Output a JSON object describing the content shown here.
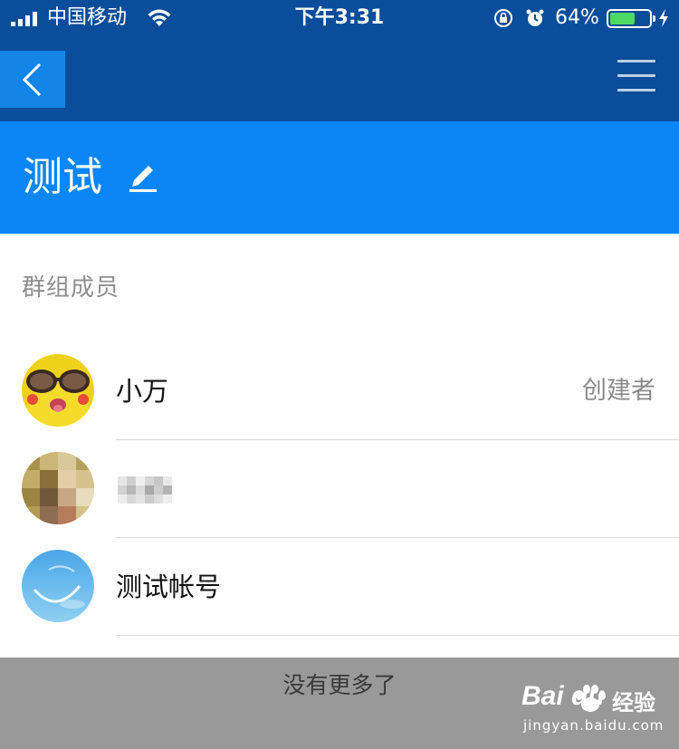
{
  "status_bar": {
    "carrier": "中国移动",
    "time": "下午3:31",
    "battery_percent": "64%",
    "battery_level": 0.64,
    "icons": [
      "signal-icon",
      "wifi-icon",
      "rotation-lock-icon",
      "alarm-icon",
      "battery-icon",
      "charging-icon"
    ]
  },
  "nav": {
    "back_icon": "chevron-left-icon",
    "menu_icon": "hamburger-menu-icon"
  },
  "header": {
    "title": "测试",
    "edit_icon": "pencil-icon"
  },
  "members": {
    "section_label": "群组成员",
    "items": [
      {
        "name": "小万",
        "role": "创建者",
        "avatar": "pikachu-sunglasses-avatar"
      },
      {
        "name": "",
        "role": "",
        "avatar": "pixelated-avatar",
        "name_pixelated": true
      },
      {
        "name": "测试帐号",
        "role": "",
        "avatar": "sky-avatar"
      }
    ]
  },
  "footer": {
    "no_more": "没有更多了"
  },
  "watermark": {
    "logo": "Bai du",
    "cn": "经验",
    "url": "jingyan.baidu.com"
  },
  "colors": {
    "nav_bg": "#0a4d9a",
    "header_bg": "#0a86f7",
    "back_btn_bg": "#1384e8",
    "footer_bg": "#999999",
    "battery_fill": "#4cd964"
  }
}
